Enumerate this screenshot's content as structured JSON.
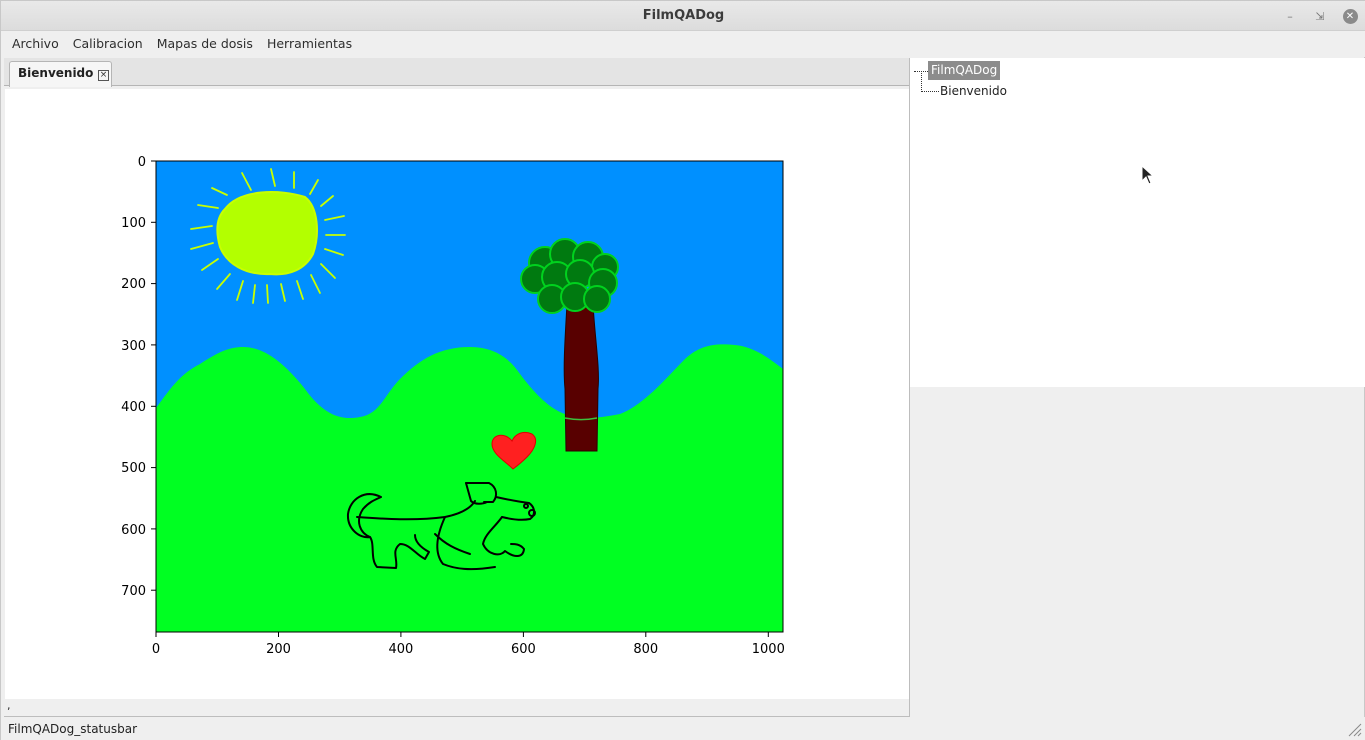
{
  "window": {
    "title": "FilmQADog"
  },
  "menubar": {
    "items": [
      "Archivo",
      "Calibracion",
      "Mapas de dosis",
      "Herramientas"
    ]
  },
  "tabs": [
    {
      "label": "Bienvenido"
    }
  ],
  "plot": {
    "x_ticks": [
      "0",
      "200",
      "400",
      "600",
      "800",
      "1000"
    ],
    "y_ticks": [
      "0",
      "100",
      "200",
      "300",
      "400",
      "500",
      "600",
      "700"
    ],
    "colors": {
      "sky": "#0090ff",
      "grass": "#00ff22",
      "sun": "#b3ff00",
      "sun_rays": "#c8ff00",
      "tree_trunk": "#580000",
      "tree_leaves": "#007a10",
      "heart": "#ff2020",
      "dog_outline": "#000000"
    }
  },
  "left_strip": {
    "text": ","
  },
  "tree": {
    "root": "FilmQADog",
    "children": [
      "Bienvenido"
    ]
  },
  "statusbar": {
    "message": "FilmQADog_statusbar"
  }
}
